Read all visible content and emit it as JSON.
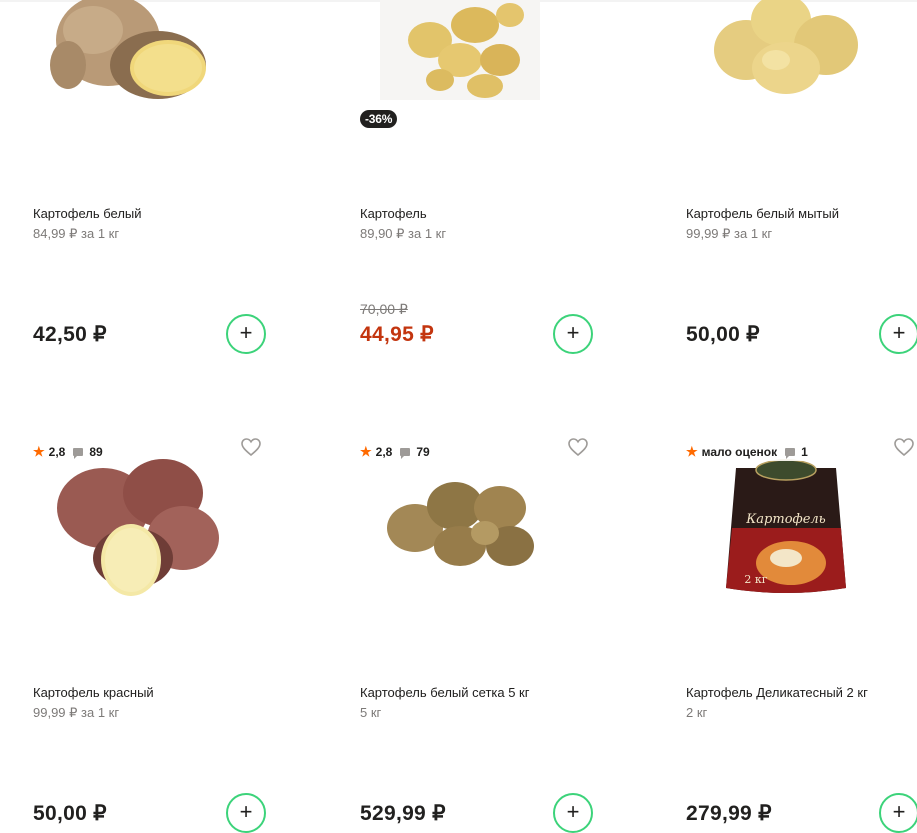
{
  "colors": {
    "accent": "#3cd37a",
    "sale_price": "#c3350f",
    "rating_star": "#ff6a00",
    "badge_bg": "#21201f"
  },
  "products": [
    {
      "title": "Картофель белый",
      "unit_price": "84,99 ₽ за 1 кг",
      "price": "42,50 ₽",
      "old_price": "",
      "discount": "",
      "rating": "",
      "reviews": "",
      "add_label": "+",
      "image": "white-potato-cut"
    },
    {
      "title": "Картофель",
      "unit_price": "89,90 ₽ за 1 кг",
      "price": "44,95 ₽",
      "old_price": "70,00 ₽",
      "discount": "-36%",
      "rating": "",
      "reviews": "",
      "add_label": "+",
      "image": "young-potatoes"
    },
    {
      "title": "Картофель белый мытый",
      "unit_price": "99,99 ₽ за 1 кг",
      "price": "50,00 ₽",
      "old_price": "",
      "discount": "",
      "rating": "",
      "reviews": "",
      "add_label": "+",
      "image": "washed-potatoes"
    },
    {
      "title": "Картофель красный",
      "unit_price": "99,99 ₽ за 1 кг",
      "price": "50,00 ₽",
      "old_price": "",
      "discount": "",
      "rating": "2,8",
      "reviews": "89",
      "add_label": "+",
      "image": "red-potato-cut"
    },
    {
      "title": "Картофель белый сетка 5 кг",
      "unit_price": "5 кг",
      "price": "529,99 ₽",
      "old_price": "",
      "discount": "",
      "rating": "2,8",
      "reviews": "79",
      "add_label": "+",
      "image": "unwashed-potatoes"
    },
    {
      "title": "Картофель Деликатесный 2 кг",
      "unit_price": "2 кг",
      "price": "279,99 ₽",
      "old_price": "",
      "discount": "",
      "rating": "мало оценок",
      "reviews": "1",
      "add_label": "+",
      "image": "potato-bag",
      "package_text": "Картофель",
      "package_weight": "2 кг"
    }
  ]
}
